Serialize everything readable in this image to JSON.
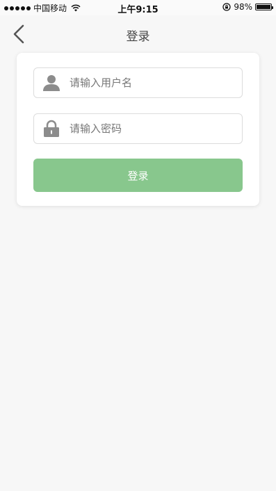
{
  "status_bar": {
    "carrier": "中国移动",
    "time": "上午9:15",
    "battery": "98%",
    "battery_level": 0.98
  },
  "nav": {
    "title": "登录"
  },
  "form": {
    "username_placeholder": "请输入用户名",
    "password_placeholder": "请输入密码",
    "login_label": "登录",
    "button_color": "#88c78d"
  },
  "icons": {
    "back": "chevron-left-icon",
    "user": "user-icon",
    "lock": "lock-icon",
    "wifi": "wifi-icon"
  }
}
